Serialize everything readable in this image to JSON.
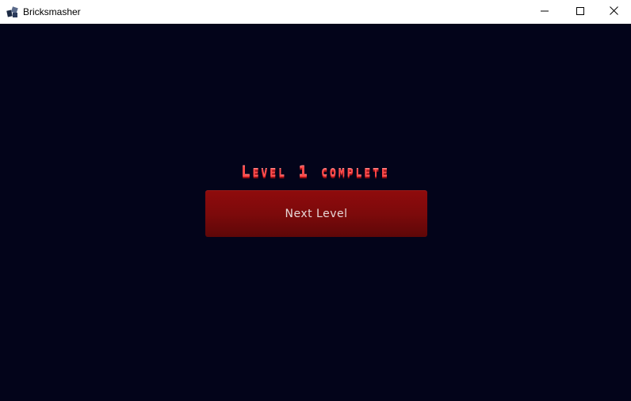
{
  "window": {
    "title": "Bricksmasher",
    "icon": "app-icon",
    "controls": [
      "minimize-icon",
      "maximize-icon",
      "close-icon"
    ]
  },
  "game": {
    "level_message": "Level 1 complete",
    "next_button_label": "Next Level"
  },
  "colors": {
    "background": "#03041a",
    "title_text": "#ff4a4a",
    "button": "#7d0a0b",
    "button_text": "#e6d6d6"
  }
}
